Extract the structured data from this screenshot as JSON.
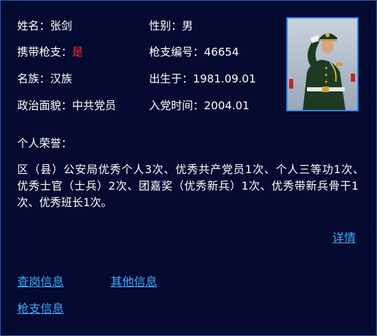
{
  "profile": {
    "name_label": "姓名：",
    "name": "张剑",
    "gender_label": "性别：",
    "gender": "男",
    "carry_gun_label": "携带枪支：",
    "carry_gun": "是",
    "gun_no_label": "枪支编号：",
    "gun_no": "46654",
    "ethnicity_label": "名族：",
    "ethnicity": "汉族",
    "birth_label": "出生于：",
    "birth": "1981.09.01",
    "political_label": "政治面貌：",
    "political": "中共党员",
    "party_date_label": "入党时间：",
    "party_date": "2004.01"
  },
  "honors": {
    "title": "个人荣誉：",
    "text": "区（县）公安局优秀个人3次、优秀共产党员1次、个人三等功1次、　优秀士官（士兵）2次、团嘉奖（优秀新兵）1次、优秀带新兵骨干1　次、优秀班长1次。"
  },
  "links": {
    "details": "详情",
    "duty_info": "查岗信息",
    "other_info": "其他信息",
    "gun_info": "枪支信息"
  },
  "colors": {
    "background": "#050a30",
    "border": "#1e5fb8",
    "link": "#3fa9ff",
    "highlight": "#ff2a2a"
  }
}
